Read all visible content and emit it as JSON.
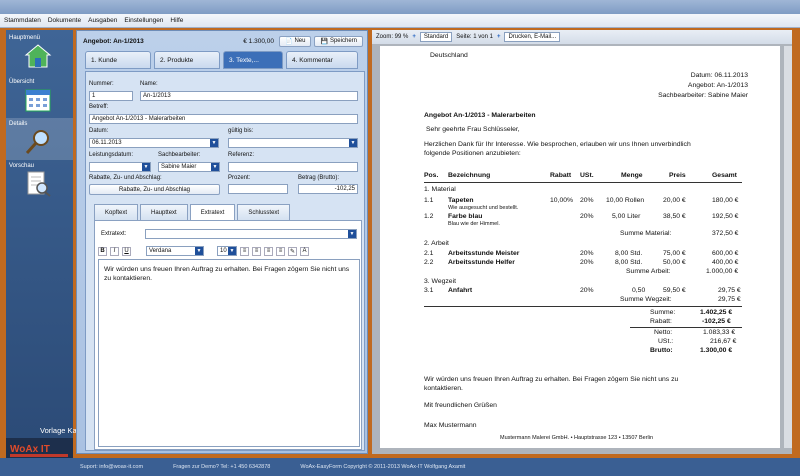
{
  "menu": [
    "Stammdaten",
    "Dokumente",
    "Ausgaben",
    "Einstellungen",
    "Hilfe"
  ],
  "nav": [
    "Hauptmenü",
    "Übersicht",
    "Details",
    "Vorschau"
  ],
  "watermark": "Vorlage Kata",
  "logo": "WoAx IT",
  "editor": {
    "title": "Angebot: An-1/2013",
    "amount": "€ 1.300,00",
    "new_label": "Neu",
    "save_label": "Speichern",
    "tabs": [
      "1. Kunde",
      "2. Produkte",
      "3. Texte,...",
      "4. Kommentar"
    ],
    "labels": {
      "nummer": "Nummer:",
      "name": "Name:",
      "betreff": "Betreff:",
      "datum": "Datum:",
      "gueltig": "gültig bis:",
      "leistung": "Leistungsdatum:",
      "sachbearbeiter": "Sachbearbeiter:",
      "referenz": "Referenz:",
      "rabatte": "Rabatte, Zu- und Abschlag:",
      "prozent": "Prozent:",
      "betrag": "Betrag (Brutto):",
      "extratext": "Extratext:"
    },
    "values": {
      "nummer": "1",
      "name": "An-1/2013",
      "betreff": "Angebot An-1/2013 - Malerarbeiten",
      "datum": "06.11.2013",
      "sachbearbeiter": "Sabine Maier",
      "rabatt_button": "Rabatte, Zu- und Abschlag",
      "betrag": "-102,25",
      "font": "Verdana",
      "size": "10"
    },
    "subtabs": [
      "Kopftext",
      "Haupttext",
      "Extratext",
      "Schlusstext"
    ],
    "text": "Wir würden uns freuen Ihren Auftrag zu erhalten. Bei Fragen zögern Sie nicht uns zu kontaktieren."
  },
  "viewer": {
    "zoom": "Zoom: 99 %",
    "mode": "Standard",
    "page": "Seite: 1 von 1",
    "print": "Drucken, E-Mail..."
  },
  "doc": {
    "city": "Deutschland",
    "datum": "Datum: 06.11.2013",
    "angebot": "Angebot: An-1/2013",
    "sachbearbeiter": "Sachbearbeiter: Sabine Maier",
    "title": "Angebot An-1/2013 - Malerarbeiten",
    "greeting": "Sehr geehrte Frau Schlüsseler,",
    "intro1": "Herzlichen Dank für Ihr Interesse. Wie besprochen, erlauben wir uns Ihnen unverbindlich",
    "intro2": "folgende Positionen anzubieten:",
    "cols": [
      "Pos.",
      "Bezeichnung",
      "Rabatt",
      "USt.",
      "Menge",
      "Preis",
      "Gesamt"
    ],
    "groups": [
      {
        "title": "1. Material",
        "rows": [
          {
            "pos": "1.1",
            "name": "Tapeten",
            "sub": "Wie ausgesucht und bestellt.",
            "rabatt": "10,00%",
            "ust": "20%",
            "menge": "10,00 Rollen",
            "preis": "20,00 €",
            "gesamt": "180,00 €"
          },
          {
            "pos": "1.2",
            "name": "Farbe blau",
            "sub": "Blau wie der Himmel.",
            "rabatt": "",
            "ust": "20%",
            "menge": "5,00 Liter",
            "preis": "38,50 €",
            "gesamt": "192,50 €"
          }
        ],
        "sum_label": "Summe Material:",
        "sum": "372,50 €"
      },
      {
        "title": "2. Arbeit",
        "rows": [
          {
            "pos": "2.1",
            "name": "Arbeitsstunde Meister",
            "sub": "",
            "rabatt": "",
            "ust": "20%",
            "menge": "8,00 Std.",
            "preis": "75,00 €",
            "gesamt": "600,00 €"
          },
          {
            "pos": "2.2",
            "name": "Arbeitsstunde Helfer",
            "sub": "",
            "rabatt": "",
            "ust": "20%",
            "menge": "8,00 Std.",
            "preis": "50,00 €",
            "gesamt": "400,00 €"
          }
        ],
        "sum_label": "Summe Arbeit:",
        "sum": "1.000,00 €"
      },
      {
        "title": "3. Wegzeit",
        "rows": [
          {
            "pos": "3.1",
            "name": "Anfahrt",
            "sub": "",
            "rabatt": "",
            "ust": "20%",
            "menge": "0,50",
            "preis": "59,50 €",
            "gesamt": "29,75 €"
          }
        ],
        "sum_label": "Summe Wegzeit:",
        "sum": "29,75 €"
      }
    ],
    "totals": [
      [
        "Summe:",
        "1.402,25 €"
      ],
      [
        "Rabatt:",
        "-102,25 €"
      ],
      [
        "Netto:",
        "1.083,33 €"
      ],
      [
        "USt.:",
        "216,67 €"
      ],
      [
        "Brutto:",
        "1.300,00 €"
      ]
    ],
    "closing1": "Wir würden uns freuen Ihren Auftrag zu erhalten. Bei Fragen zögern Sie nicht uns zu",
    "closing2": "kontaktieren.",
    "regards": "Mit freundlichen Grüßen",
    "signer": "Max Mustermann",
    "footer": "Mustermann Malerei GmbH. • Hauptstrasse 123 • 13507 Berlin"
  },
  "status": {
    "left": "Suport: info@woax-it.com",
    "mid": "Fragen zur Demo? Tel: +1 450 6342878",
    "right": "WoAx-EasyForm Copyright © 2011-2013 WoAx-IT Wolfgang Axamit"
  }
}
